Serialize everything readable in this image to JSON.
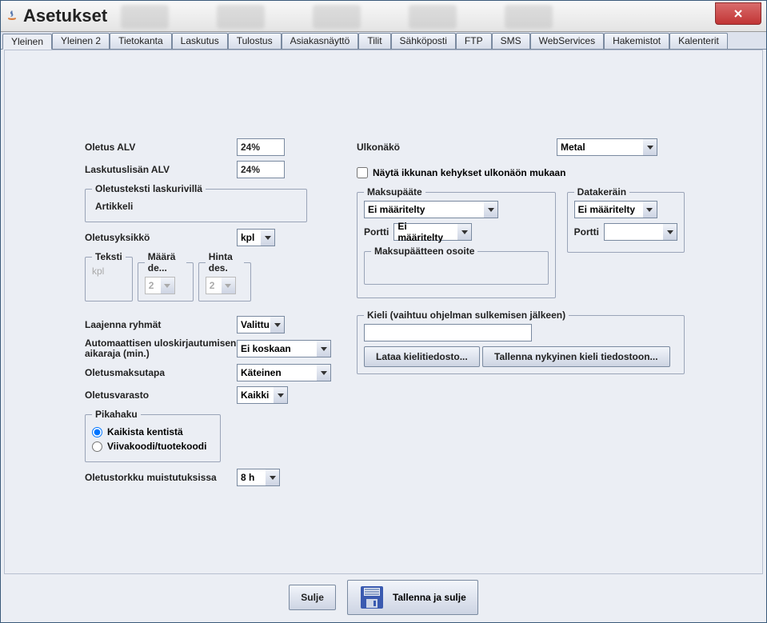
{
  "window": {
    "title": "Asetukset"
  },
  "tabs": [
    "Yleinen",
    "Yleinen 2",
    "Tietokanta",
    "Laskutus",
    "Tulostus",
    "Asiakasnäyttö",
    "Tilit",
    "Sähköposti",
    "FTP",
    "SMS",
    "WebServices",
    "Hakemistot",
    "Kalenterit"
  ],
  "active_tab": 0,
  "left": {
    "oletus_alv_label": "Oletus ALV",
    "oletus_alv": "24%",
    "laskutuslisan_alv_label": "Laskutuslisän ALV",
    "laskutuslisan_alv": "24%",
    "oletusteksti_legend": "Oletusteksti laskurivillä",
    "oletusteksti": "Artikkeli",
    "oletusyksikko_label": "Oletusyksikkö",
    "oletusyksikko": "kpl",
    "teksti_legend": "Teksti",
    "teksti_val": "kpl",
    "maara_legend": "Määrä de...",
    "maara_val": "2",
    "hinta_legend": "Hinta des.",
    "hinta_val": "2",
    "laajenna_label": "Laajenna ryhmät",
    "laajenna": "Valittu",
    "auto_label1": "Automaattisen uloskirjautumisen",
    "auto_label2": "aikaraja (min.)",
    "auto_val": "Ei koskaan",
    "maksutapa_label": "Oletusmaksutapa",
    "maksutapa": "Käteinen",
    "varasto_label": "Oletusvarasto",
    "varasto": "Kaikki",
    "pikahaku_legend": "Pikahaku",
    "pikahaku_opt1": "Kaikista kentistä",
    "pikahaku_opt2": "Viivakoodi/tuotekoodi",
    "torkku_label": "Oletustorkku muistutuksissa",
    "torkku": "8 h"
  },
  "right": {
    "ulkonako_label": "Ulkonäkö",
    "ulkonako": "Metal",
    "nayta_kehykset": "Näytä ikkunan kehykset ulkonäön mukaan",
    "maksupaate_legend": "Maksupääte",
    "maksupaate_val": "Ei määritelty",
    "portti_label": "Portti",
    "portti_val": "Ei määritelty",
    "maksupaate_osoite_legend": "Maksupäätteen osoite",
    "maksupaate_osoite": "",
    "datakerain_legend": "Datakeräin",
    "datakerain_val": "Ei määritelty",
    "datakerain_portti": "",
    "kieli_legend": "Kieli (vaihtuu ohjelman sulkemisen jälkeen)",
    "kieli_val": "",
    "lataa_btn": "Lataa kielitiedosto...",
    "tallenna_btn": "Tallenna nykyinen kieli tiedostoon..."
  },
  "footer": {
    "sulje": "Sulje",
    "tallenna": "Tallenna ja sulje"
  }
}
